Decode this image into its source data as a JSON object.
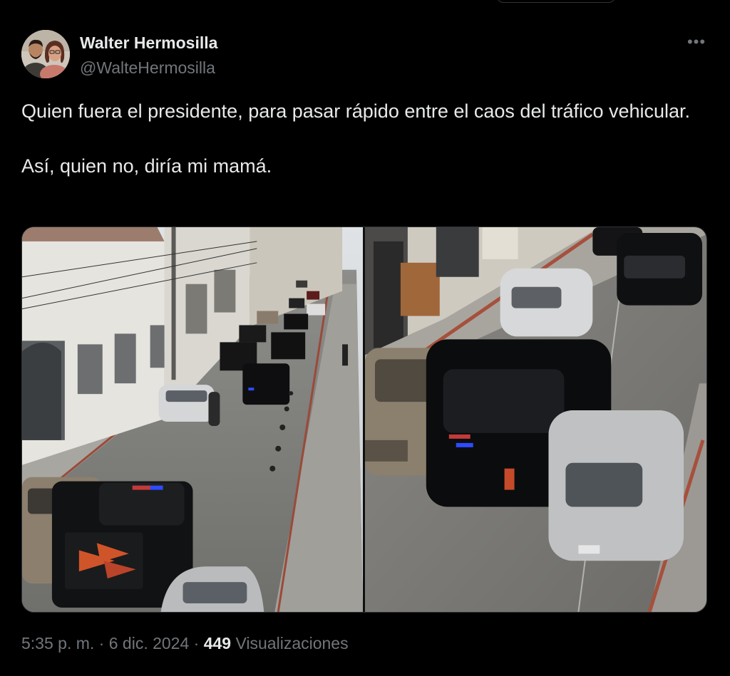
{
  "author": {
    "name": "Walter Hermosilla",
    "handle": "@WalteHermosilla"
  },
  "more_icon": "more-horizontal-icon",
  "tweet": {
    "paragraphs": [
      "Quien fuera el presidente, para pasar rápido entre el caos del tráfico vehicular.",
      "Así, quien no, diría mi mamá."
    ]
  },
  "media": {
    "count": 2
  },
  "meta": {
    "time": "5:35 p. m.",
    "separator": "·",
    "date": "6 dic. 2024",
    "views_count": "449",
    "views_label": "Visualizaciones"
  },
  "colors": {
    "background": "#000000",
    "text": "#e7e9ea",
    "secondary": "#71767b",
    "border": "#2f3336"
  }
}
